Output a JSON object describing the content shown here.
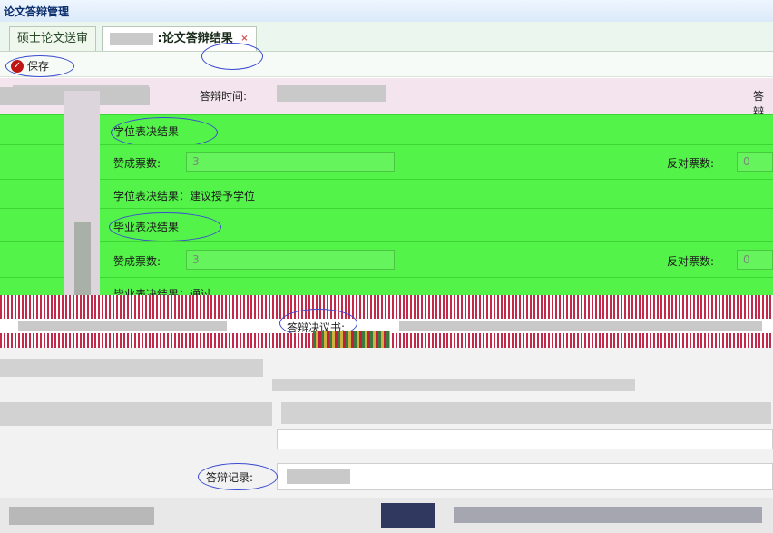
{
  "window": {
    "title": "论文答辩管理"
  },
  "tabs": [
    {
      "label": "硕士论文送审"
    },
    {
      "label": ":论文答辩结果",
      "close": "×"
    }
  ],
  "toolbar": {
    "save_label": "保存"
  },
  "info": {
    "defense_time_label": "答辩时间:",
    "right_label": "答辩"
  },
  "degree_vote": {
    "section_title": "学位表决结果",
    "yes_label": "赞成票数:",
    "yes_value": "3",
    "no_label": "反对票数:",
    "no_value": "0",
    "result_text": "学位表决结果：建议授予学位"
  },
  "graduation_vote": {
    "section_title": "毕业表决结果",
    "yes_label": "赞成票数:",
    "yes_value": "3",
    "no_label": "反对票数:",
    "no_value": "0",
    "result_text": "毕业表决结果：通过"
  },
  "resolution": {
    "label": "答辩决议书:"
  },
  "record": {
    "label": "答辩记录:"
  },
  "colors": {
    "green": "#54f34a",
    "pink": "#f3e4ed",
    "accent": "#3a4bd0"
  }
}
